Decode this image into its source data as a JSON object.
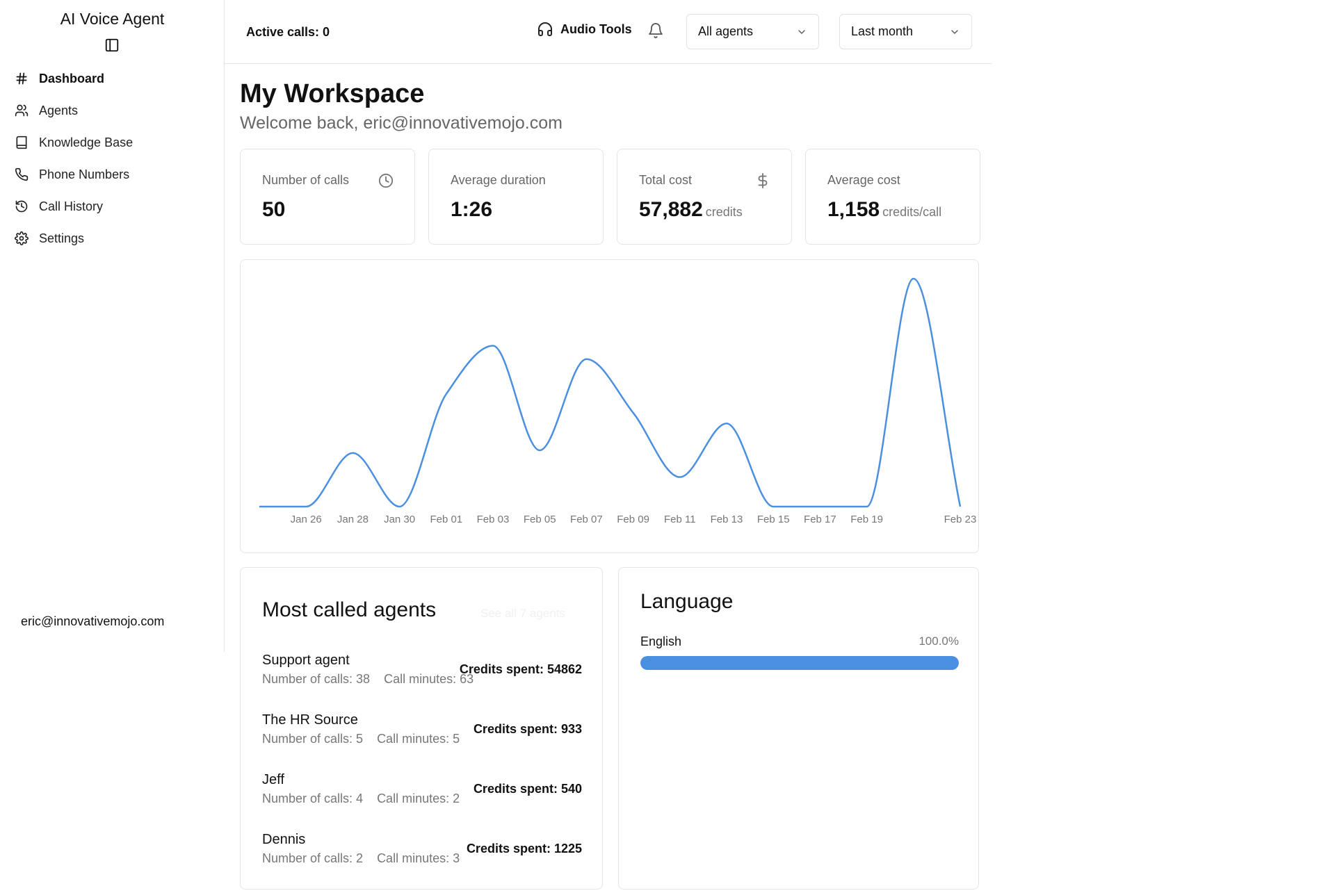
{
  "app": {
    "title": "AI Voice Agent"
  },
  "sidebar": {
    "items": [
      {
        "label": "Dashboard",
        "icon": "hash-icon",
        "active": true
      },
      {
        "label": "Agents",
        "icon": "users-icon",
        "active": false
      },
      {
        "label": "Knowledge Base",
        "icon": "book-icon",
        "active": false
      },
      {
        "label": "Phone Numbers",
        "icon": "phone-icon",
        "active": false
      },
      {
        "label": "Call History",
        "icon": "history-icon",
        "active": false
      },
      {
        "label": "Settings",
        "icon": "gear-icon",
        "active": false
      }
    ],
    "user_email": "eric@innovativemojo.com"
  },
  "topbar": {
    "active_calls": "Active calls: 0",
    "audio_tools": "Audio Tools",
    "agent_filter": "All agents",
    "period_filter": "Last month"
  },
  "main": {
    "title": "My Workspace",
    "welcome": "Welcome back, eric@innovativemojo.com"
  },
  "stats": [
    {
      "label": "Number of calls",
      "value": "50",
      "unit": "",
      "icon": "clock-icon"
    },
    {
      "label": "Average duration",
      "value": "1:26",
      "unit": "",
      "icon": ""
    },
    {
      "label": "Total cost",
      "value": "57,882",
      "unit": "credits",
      "icon": "dollar-icon"
    },
    {
      "label": "Average cost",
      "value": "1,158",
      "unit": "credits/call",
      "icon": ""
    }
  ],
  "chart_data": {
    "type": "line",
    "title": "",
    "xlabel": "",
    "ylabel": "",
    "grid": false,
    "color": "#4a8fe0",
    "x_ticks": [
      "Jan 26",
      "Jan 28",
      "Jan 30",
      "Feb 01",
      "Feb 03",
      "Feb 05",
      "Feb 07",
      "Feb 09",
      "Feb 11",
      "Feb 13",
      "Feb 15",
      "Feb 17",
      "Feb 19",
      "Feb 23"
    ],
    "x": [
      "Jan 24",
      "Jan 26",
      "Jan 28",
      "Jan 30",
      "Feb 01",
      "Feb 03",
      "Feb 05",
      "Feb 07",
      "Feb 09",
      "Feb 11",
      "Feb 13",
      "Feb 15",
      "Feb 17",
      "Feb 19",
      "Feb 21",
      "Feb 23"
    ],
    "values": [
      0,
      0,
      2,
      0,
      4.2,
      6,
      2.1,
      5.5,
      3.5,
      1.1,
      3.1,
      0,
      0,
      0,
      8.5,
      0
    ],
    "ylim": [
      0,
      8.5
    ]
  },
  "agents_card": {
    "title": "Most called agents",
    "see_all": "See all 7 agents",
    "agents": [
      {
        "name": "Support agent",
        "calls": "Number of calls: 38",
        "minutes": "Call minutes: 63",
        "credits": "Credits spent: 54862"
      },
      {
        "name": "The HR Source",
        "calls": "Number of calls: 5",
        "minutes": "Call minutes: 5",
        "credits": "Credits spent: 933"
      },
      {
        "name": "Jeff",
        "calls": "Number of calls: 4",
        "minutes": "Call minutes: 2",
        "credits": "Credits spent: 540"
      },
      {
        "name": "Dennis",
        "calls": "Number of calls: 2",
        "minutes": "Call minutes: 3",
        "credits": "Credits spent: 1225"
      }
    ]
  },
  "language_card": {
    "title": "Language",
    "languages": [
      {
        "name": "English",
        "percent_label": "100.0%",
        "fraction": 1.0
      }
    ]
  }
}
